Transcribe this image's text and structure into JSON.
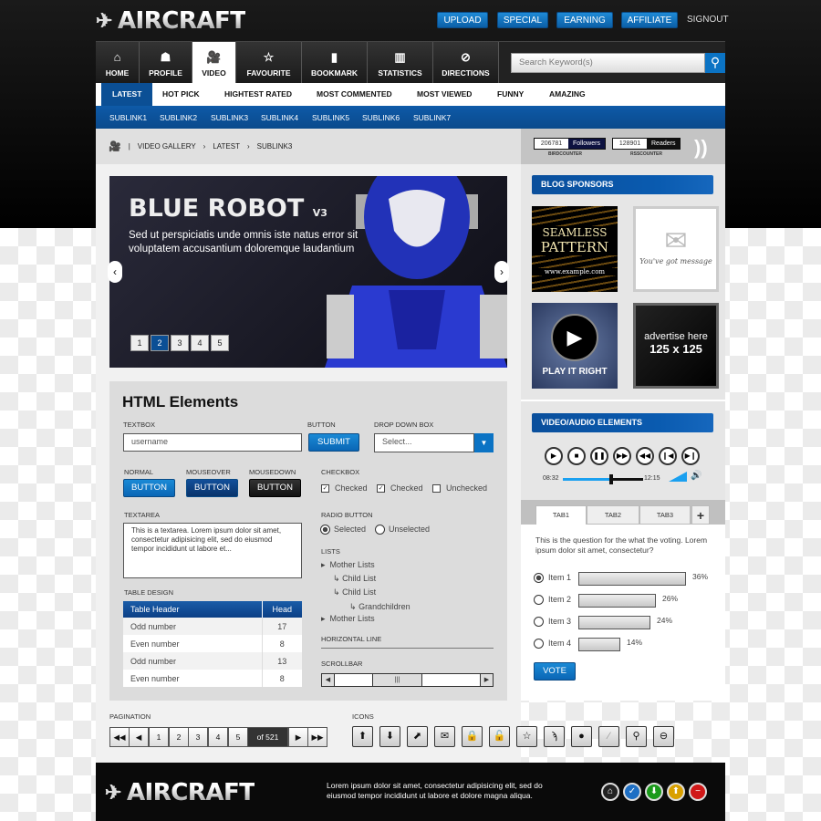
{
  "brand": {
    "name": "AIRCRAFT"
  },
  "header": {
    "buttons": [
      "UPLOAD",
      "SPECIAL",
      "EARNING",
      "AFFILIATE"
    ],
    "signout": "SIGNOUT"
  },
  "nav": {
    "tabs": [
      {
        "label": "HOME",
        "icon": "home-icon"
      },
      {
        "label": "PROFILE",
        "icon": "profile-icon"
      },
      {
        "label": "VIDEO",
        "icon": "video-camera-icon",
        "active": true
      },
      {
        "label": "FAVOURITE",
        "icon": "star-icon"
      },
      {
        "label": "BOOKMARK",
        "icon": "notebook-icon"
      },
      {
        "label": "STATISTICS",
        "icon": "bar-chart-icon"
      },
      {
        "label": "DIRECTIONS",
        "icon": "compass-icon"
      }
    ],
    "search_placeholder": "Search Keyword(s)"
  },
  "subnav": [
    "LATEST",
    "HOT PICK",
    "HIGHTEST RATED",
    "MOST COMMENTED",
    "MOST VIEWED",
    "FUNNY",
    "AMAZING"
  ],
  "sublinks": [
    "SUBLINK1",
    "SUBLINK2",
    "SUBLINK3",
    "SUBLINK4",
    "SUBLINK5",
    "SUBLINK6",
    "SUBLINK7"
  ],
  "breadcrumb": [
    "VIDEO GALLERY",
    "LATEST",
    "SUBLINK3"
  ],
  "counters": {
    "followers": {
      "value": "206781",
      "label": "Followers",
      "caption": "BIRDCOUNTER"
    },
    "readers": {
      "value": "128901",
      "label": "Readers",
      "caption": "RSSCOUNTER"
    }
  },
  "slider": {
    "title": "BLUE ROBOT",
    "version": "V3",
    "text": "Sed ut perspiciatis unde omnis iste natus error sit voluptatem accusantium doloremque laudantium",
    "pages": [
      "1",
      "2",
      "3",
      "4",
      "5"
    ],
    "active_page": "2"
  },
  "elements": {
    "title": "HTML Elements",
    "textbox_label": "TEXTBOX",
    "textbox_value": "username",
    "button_label": "BUTTON",
    "submit": "SUBMIT",
    "dropdown_label": "DROP DOWN BOX",
    "dropdown_value": "Select...",
    "states": [
      {
        "label": "NORMAL",
        "button": "BUTTON"
      },
      {
        "label": "MOUSEOVER",
        "button": "BUTTON"
      },
      {
        "label": "MOUSEDOWN",
        "button": "BUTTON"
      }
    ],
    "checkbox_label": "CHECKBOX",
    "checkboxes": [
      {
        "label": "Checked",
        "checked": true
      },
      {
        "label": "Checked",
        "checked": true
      },
      {
        "label": "Unchecked",
        "checked": false
      }
    ],
    "textarea_label": "TEXTAREA",
    "textarea_value": "This is a textarea. Lorem ipsum dolor sit amet, consectetur adipisicing elit, sed do eiusmod tempor incididunt ut labore et...",
    "radio_label": "RADIO BUTTON",
    "radios": [
      "Selected",
      "Unselected"
    ],
    "lists_label": "LISTS",
    "lists": [
      "Mother Lists",
      "Child List",
      "Child List",
      "Grandchildren",
      "Mother Lists"
    ],
    "hline_label": "HORIZONTAL LINE",
    "scrollbar_label": "SCROLLBAR",
    "table_label": "TABLE DESIGN",
    "table": {
      "headers": [
        "Table Header",
        "Head"
      ],
      "rows": [
        [
          "Odd number",
          "17"
        ],
        [
          "Even number",
          "8"
        ],
        [
          "Odd number",
          "13"
        ],
        [
          "Even number",
          "8"
        ]
      ]
    }
  },
  "sidebar": {
    "sponsors_title": "BLOG SPONSORS",
    "ads": {
      "pattern_title1": "SEAMLESS",
      "pattern_title2": "PATTERN",
      "pattern_url": "www.example.com",
      "message": "You've got message",
      "play": "PLAY IT RIGHT",
      "advertise": "advertise here",
      "size": "125 x 125"
    },
    "media_title": "VIDEO/AUDIO ELEMENTS",
    "media": {
      "current": "08:32",
      "total": "12:15",
      "progress": 0.6,
      "volume": 0.8
    }
  },
  "poll": {
    "tabs": [
      "TAB1",
      "TAB2",
      "TAB3",
      "+"
    ],
    "question": "This is the question for the what the voting. Lorem ipsum dolor sit amet, consectetur?",
    "items": [
      {
        "label": "Item 1",
        "pct": "36%",
        "value": 36,
        "selected": true
      },
      {
        "label": "Item 2",
        "pct": "26%",
        "value": 26
      },
      {
        "label": "Item 3",
        "pct": "24%",
        "value": 24
      },
      {
        "label": "Item 4",
        "pct": "14%",
        "value": 14
      }
    ],
    "vote": "VOTE"
  },
  "pagination": {
    "label": "PAGINATION",
    "pages": [
      "1",
      "2",
      "3",
      "4",
      "5"
    ],
    "of": "of 521"
  },
  "icons": {
    "label": "ICONS",
    "items": [
      "arrow-up-icon",
      "arrow-down-icon",
      "arrow-diagonal-icon",
      "mail-icon",
      "lock-icon",
      "unlock-icon",
      "star-icon",
      "rss-icon",
      "comment-icon",
      "paperclip-icon",
      "search-icon",
      "minus-circle-icon"
    ]
  },
  "footer": {
    "text": "Lorem ipsum dolor sit amet, consectetur adipisicing elit, sed do eiusmod tempor incididunt ut labore et dolore magna aliqua."
  },
  "colors": {
    "accent": "#0b5fa6",
    "dark": "#0a0a0a"
  }
}
